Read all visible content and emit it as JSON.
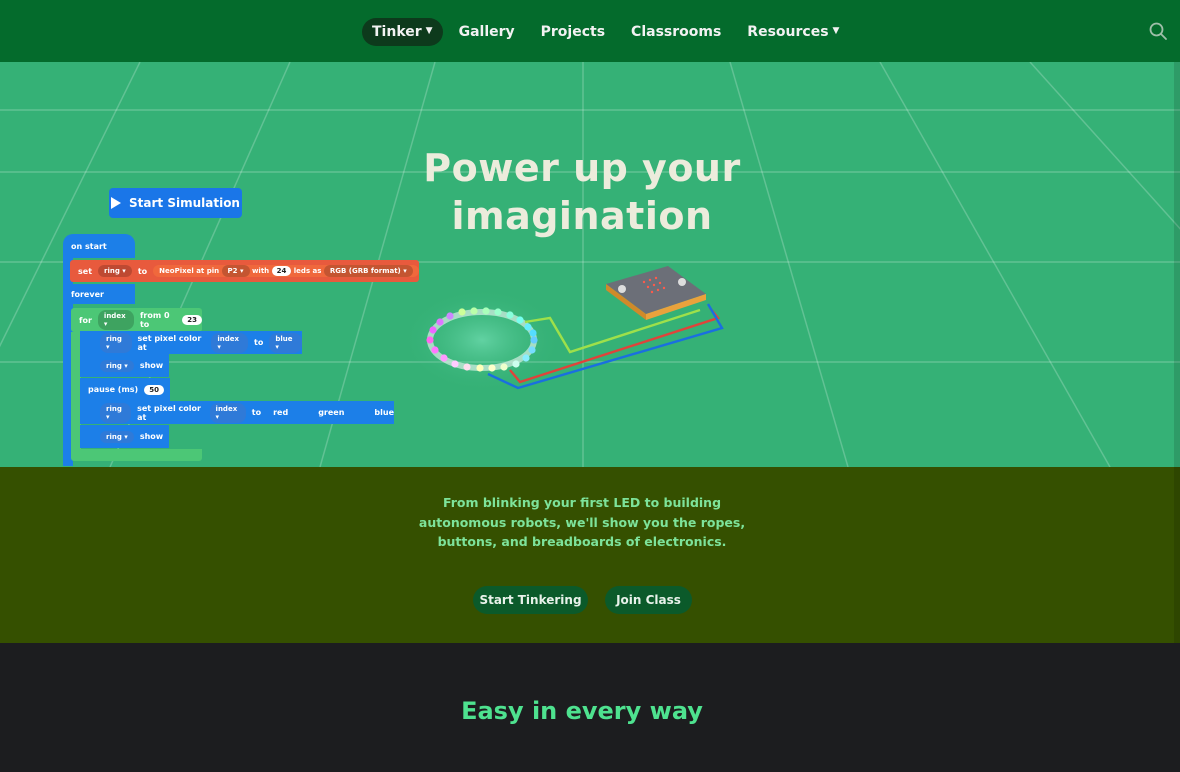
{
  "nav": {
    "items": [
      {
        "label": "Tinker",
        "has_dropdown": true,
        "active": true
      },
      {
        "label": "Gallery",
        "has_dropdown": false
      },
      {
        "label": "Projects",
        "has_dropdown": false
      },
      {
        "label": "Classrooms",
        "has_dropdown": false
      },
      {
        "label": "Resources",
        "has_dropdown": true
      }
    ],
    "search_icon": "search-icon"
  },
  "hero": {
    "headline_line1": "Power up your",
    "headline_line2": "imagination",
    "sim_button": "Start Simulation",
    "code": {
      "on_start": "on start",
      "set": "set",
      "ring": "ring",
      "to": "to",
      "neopixel": "NeoPixel at pin",
      "pin": "P2",
      "with": "with",
      "count": "24",
      "leds_as": "leds as",
      "format": "RGB (GRB format)",
      "forever": "forever",
      "for": "for",
      "index": "index",
      "from_to": "from 0 to",
      "max": "23",
      "set_pixel": "set pixel color at",
      "blue": "blue",
      "show": "show",
      "pause": "pause (ms)",
      "pause_val": "50",
      "red": "red",
      "green": "green"
    }
  },
  "intro": {
    "text": "From blinking your first LED to building autonomous robots, we'll show you the ropes, buttons, and breadboards of electronics.",
    "start_button": "Start Tinkering",
    "join_button": "Join Class"
  },
  "section2": {
    "title": "Easy in every way"
  },
  "colors": {
    "nav": "#046b2c",
    "hero": "#35b176",
    "intro": "#355000",
    "accent": "#4ee28f",
    "dark": "#1c1d1f"
  }
}
